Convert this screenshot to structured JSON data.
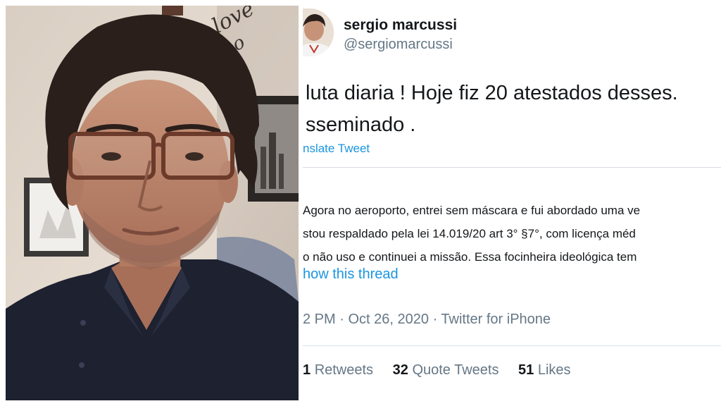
{
  "tweet": {
    "display_name": "sergio marcussi",
    "handle": "@sergiomarcussi",
    "text_lines": [
      "luta diaria ! Hoje fiz 20 atestados desses.",
      "sseminado ."
    ],
    "translate_label": "nslate Tweet",
    "quoted_lines": [
      "Agora no aeroporto, entrei sem máscara e fui abordado uma ve",
      "stou respaldado pela lei 14.019/20 art 3° §7°, com licença méd",
      "o não uso e continuei a missão. Essa focinheira ideológica tem"
    ],
    "show_thread": "how this thread",
    "time": "2 PM",
    "date": "Oct 26, 2020",
    "client": "Twitter for iPhone",
    "retweets_count": "1",
    "retweets_label": "Retweets",
    "quote_count": "32",
    "quote_label": "Quote Tweets",
    "likes_count": "51",
    "likes_label": "Likes"
  },
  "photo": {
    "wall_text": "love"
  },
  "colors": {
    "link": "#1b95e0",
    "secondary_text": "#657786",
    "primary_text": "#14171a",
    "divider": "#d8dee3"
  }
}
